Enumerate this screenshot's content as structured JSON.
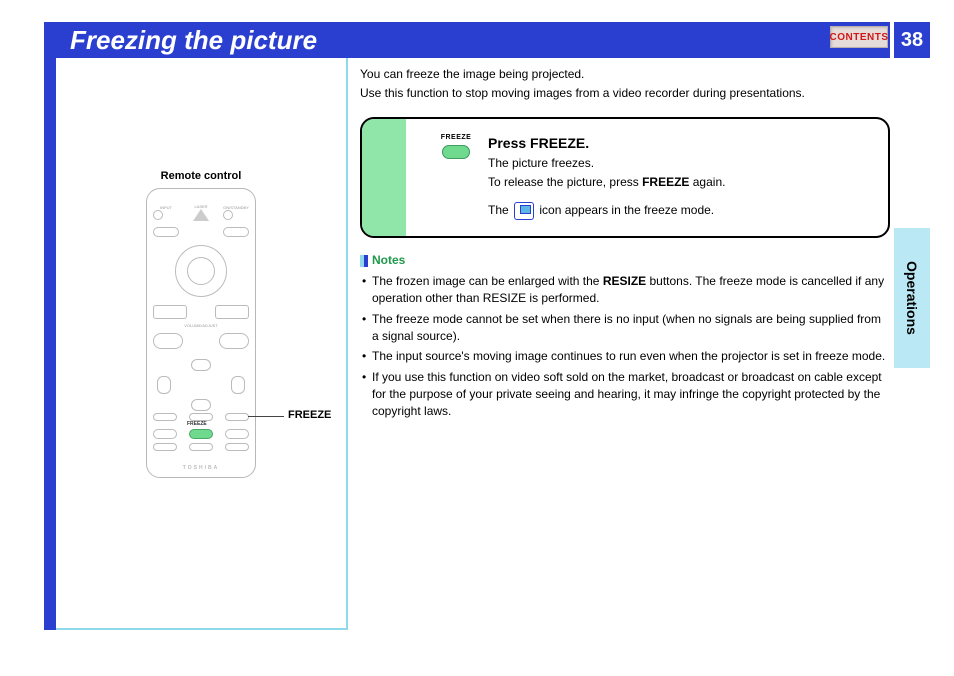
{
  "header": {
    "title": "Freezing the picture",
    "contents_label": "CONTENTS",
    "page_number": "38"
  },
  "side_tab": "Operations",
  "left": {
    "remote_label": "Remote control",
    "callout": "FREEZE",
    "brand": "TOSHIBA",
    "freeze_btn_label": "FREEZE"
  },
  "intro": {
    "line1": "You can freeze the image being projected.",
    "line2": "Use this function to stop moving images from a video recorder during presentations."
  },
  "instruction": {
    "chip_label": "FREEZE",
    "title": "Press FREEZE.",
    "line1": "The picture freezes.",
    "line2_a": "To release the picture, press ",
    "line2_b": "FREEZE",
    "line2_c": " again.",
    "line3_a": "The ",
    "line3_b": " icon appears in the freeze mode."
  },
  "notes_label": "Notes",
  "notes": [
    {
      "pre": "The frozen image can be enlarged with the ",
      "bold": "RESIZE",
      "post": " buttons. The freeze mode is cancelled if any operation other than RESIZE is performed."
    },
    {
      "pre": "The freeze mode cannot be set when there is no input (when no signals are being supplied from a signal source).",
      "bold": "",
      "post": ""
    },
    {
      "pre": "The input source's moving image continues to run even when the projector is set in freeze mode.",
      "bold": "",
      "post": ""
    },
    {
      "pre": "If you use this function on video soft sold on the market, broadcast or broadcast on cable except for the purpose of your private seeing and hearing, it may infringe the copyright protected by the copyright laws.",
      "bold": "",
      "post": ""
    }
  ]
}
